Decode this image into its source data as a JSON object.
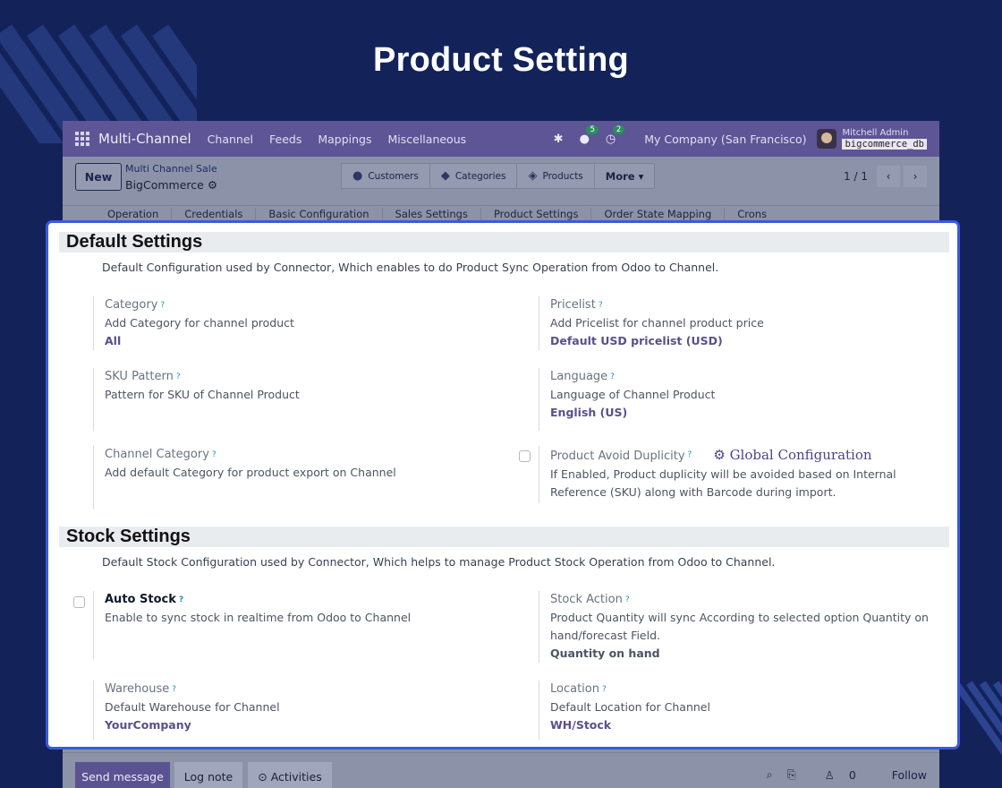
{
  "hero": {
    "title": "Product Setting"
  },
  "navbar": {
    "brand": "Multi-Channel",
    "menus": [
      "Channel",
      "Feeds",
      "Mappings",
      "Miscellaneous"
    ],
    "messages_count": "5",
    "activities_count": "2",
    "company": "My Company (San Francisco)",
    "user": "Mitchell Admin",
    "database": "bigcommerce_db"
  },
  "control": {
    "new_label": "New",
    "breadcrumb_parent": "Multi Channel Sale",
    "breadcrumb_current": "BigCommerce",
    "smart_buttons": [
      "Customers",
      "Categories",
      "Products"
    ],
    "more_label": "More ▾",
    "pager": "1 / 1"
  },
  "tabs": [
    "Operation",
    "Credentials",
    "Basic Configuration",
    "Sales Settings",
    "Product Settings",
    "Order State Mapping",
    "Crons"
  ],
  "default_settings": {
    "title": "Default Settings",
    "description": "Default Configuration used by Connector, Which enables to do Product Sync Operation from Odoo to Channel.",
    "category": {
      "label": "Category",
      "desc": "Add Category for channel product",
      "value": "All"
    },
    "pricelist": {
      "label": "Pricelist",
      "desc": "Add Pricelist for channel product price",
      "value": "Default USD pricelist (USD)"
    },
    "sku": {
      "label": "SKU Pattern",
      "desc": "Pattern for SKU of Channel Product"
    },
    "language": {
      "label": "Language",
      "desc": "Language of Channel Product",
      "value": "English (US)"
    },
    "channel_category": {
      "label": "Channel Category",
      "desc": "Add default Category for product export on Channel"
    },
    "avoid_duplicity": {
      "label": "Product Avoid Duplicity",
      "link": "Global Configuration",
      "desc_line1": "If Enabled, Product duplicity will be avoided based on Internal",
      "desc_line2": "Reference (SKU) along with Barcode during import."
    }
  },
  "stock_settings": {
    "title": "Stock Settings",
    "description": "Default Stock Configuration used by Connector, Which helps to manage Product Stock Operation from Odoo to Channel.",
    "auto_stock": {
      "label": "Auto Stock",
      "desc": "Enable to sync stock in realtime from Odoo to Channel"
    },
    "stock_action": {
      "label": "Stock Action",
      "desc_line1": "Product Quantity will sync According to selected option Quantity on",
      "desc_line2": "hand/forecast Field.",
      "value": "Quantity on hand"
    },
    "warehouse": {
      "label": "Warehouse",
      "desc": "Default Warehouse for Channel",
      "value": "YourCompany"
    },
    "location": {
      "label": "Location",
      "desc": "Default Location for Channel",
      "value": "WH/Stock"
    }
  },
  "chatter": {
    "send_label": "Send message",
    "log_label": "Log note",
    "activities_label": "⊙ Activities",
    "followers_count": "0",
    "follow_label": "Follow"
  },
  "colors": {
    "background": "#13235a",
    "highlight_border": "#3b5bdb",
    "navbar": "#5d5596"
  }
}
